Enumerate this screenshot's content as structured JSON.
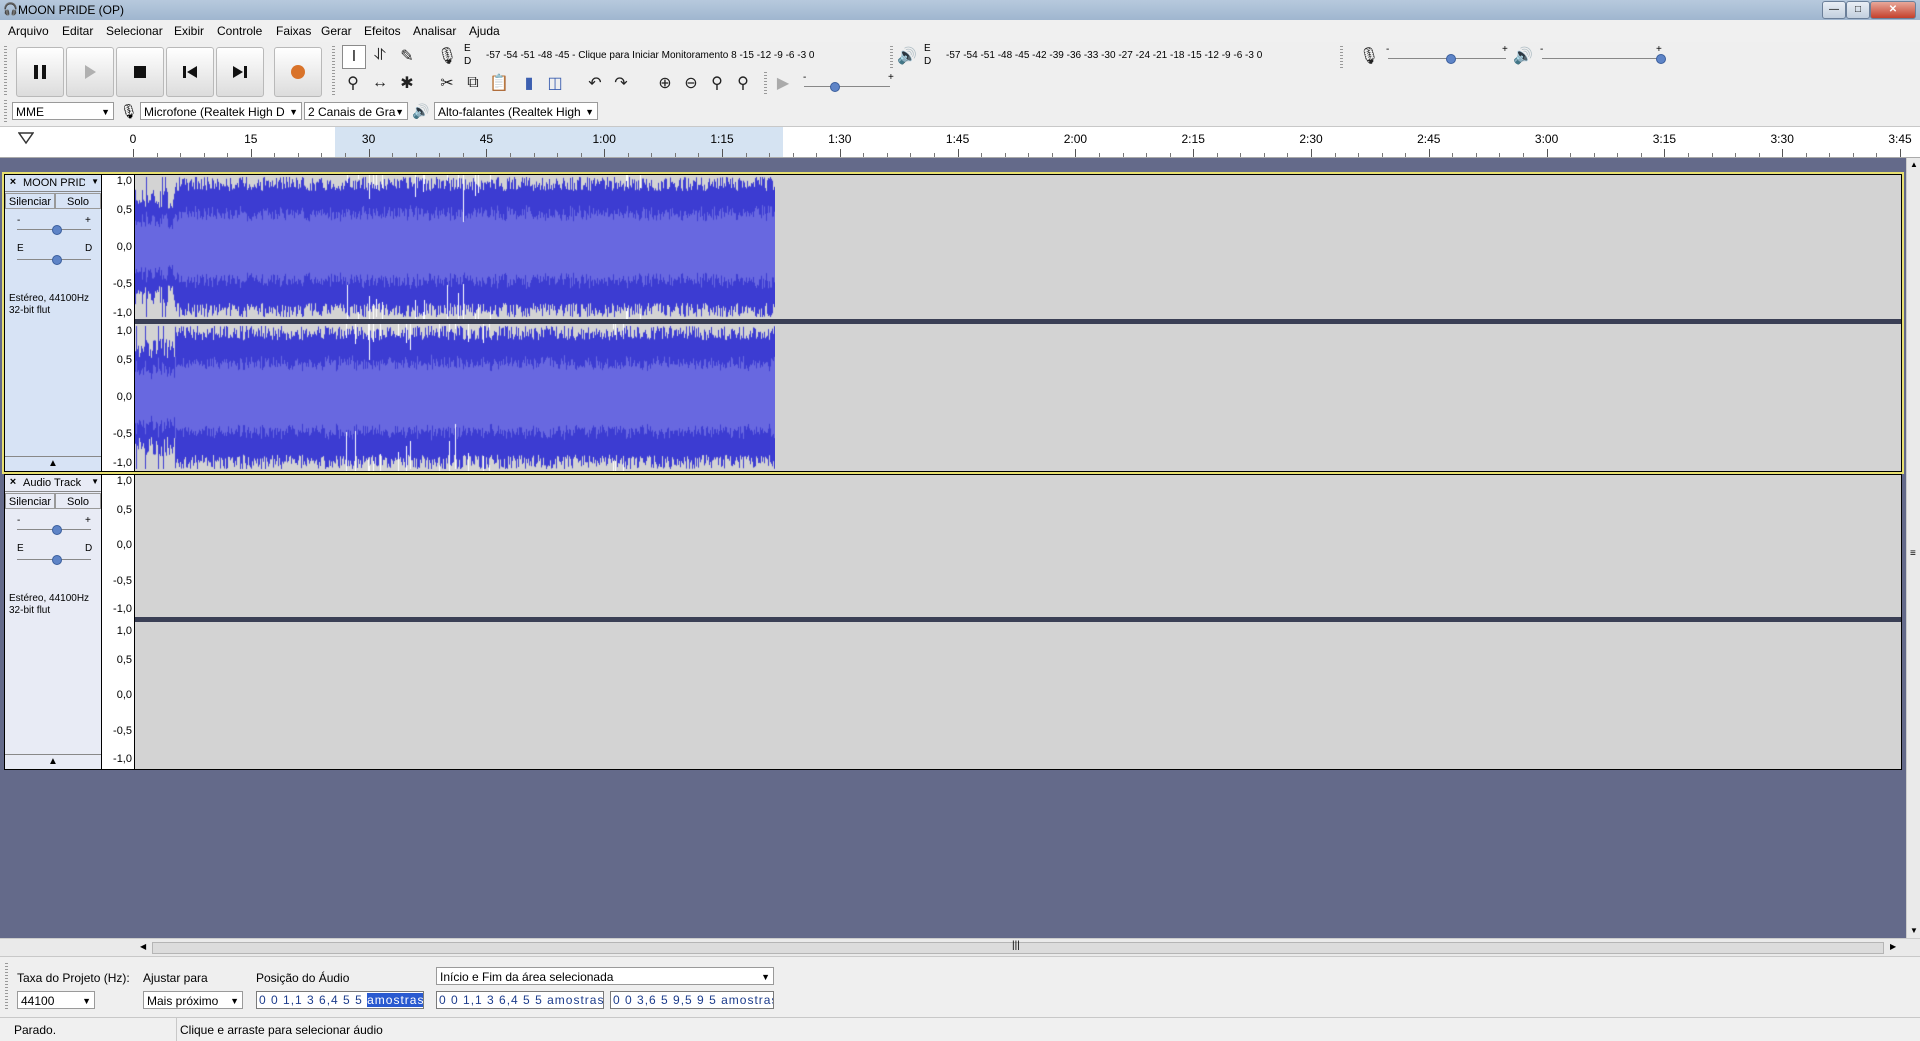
{
  "window": {
    "title": "MOON PRIDE (OP)"
  },
  "menu": [
    "Arquivo",
    "Editar",
    "Selecionar",
    "Exibir",
    "Controle",
    "Faixas",
    "Gerar",
    "Efeitos",
    "Analisar",
    "Ajuda"
  ],
  "meters": {
    "rec_scale": "-57 -54 -51 -48 -45 - Clique para Iniciar Monitoramento 8 -15 -12  -9  -6  -3  0",
    "play_scale": "-57 -54 -51 -48 -45 -42 -39 -36 -33 -30 -27 -24 -21 -18 -15 -12  -9  -6  -3  0",
    "ed_top": "E",
    "ed_bottom": "D",
    "minus": "-",
    "plus": "+"
  },
  "device": {
    "host": "MME",
    "input": "Microfone (Realtek High D",
    "channels": "2 Canais de  Gra",
    "output": "Alto-falantes (Realtek High"
  },
  "ruler": [
    "0",
    "15",
    "30",
    "45",
    "1:00",
    "1:15",
    "1:30",
    "1:45",
    "2:00",
    "2:15",
    "2:30",
    "2:45",
    "3:00",
    "3:15",
    "3:30",
    "3:45"
  ],
  "scale_labels": [
    "1,0",
    "0,5",
    "0,0",
    "-0,5",
    "-1,0"
  ],
  "tracks": [
    {
      "name": "MOON PRIDE",
      "mute": "Silenciar",
      "solo": "Solo",
      "gain_minus": "-",
      "gain_plus": "+",
      "pan_left": "E",
      "pan_right": "D",
      "format1": "Estéreo, 44100Hz",
      "format2": "32-bit flut"
    },
    {
      "name": "Audio Track",
      "mute": "Silenciar",
      "solo": "Solo",
      "gain_minus": "-",
      "gain_plus": "+",
      "pan_left": "E",
      "pan_right": "D",
      "format1": "Estéreo, 44100Hz",
      "format2": "32-bit flut"
    }
  ],
  "selection": {
    "rate_label": "Taxa do Projeto (Hz):",
    "rate_value": "44100",
    "snap_label": "Ajustar para",
    "snap_value": "Mais próximo",
    "pos_label": "Posição do Áudio",
    "range_label": "Início e Fim da área selecionada",
    "pos_value": "0 0 1,1 3 6,4 5 5",
    "start_value": "0 0 1,1 3 6,4 5 5",
    "end_value": "0 0 3,6 5 9,5 9 5",
    "unit": "amostras"
  },
  "status": {
    "state": "Parado.",
    "hint": "Clique e arraste para selecionar áudio"
  },
  "colors": {
    "waveform": "#3c3cd2",
    "waveform_rms": "#6868e0",
    "track_bg": "#d3d3d3",
    "background": "#646a8a"
  }
}
